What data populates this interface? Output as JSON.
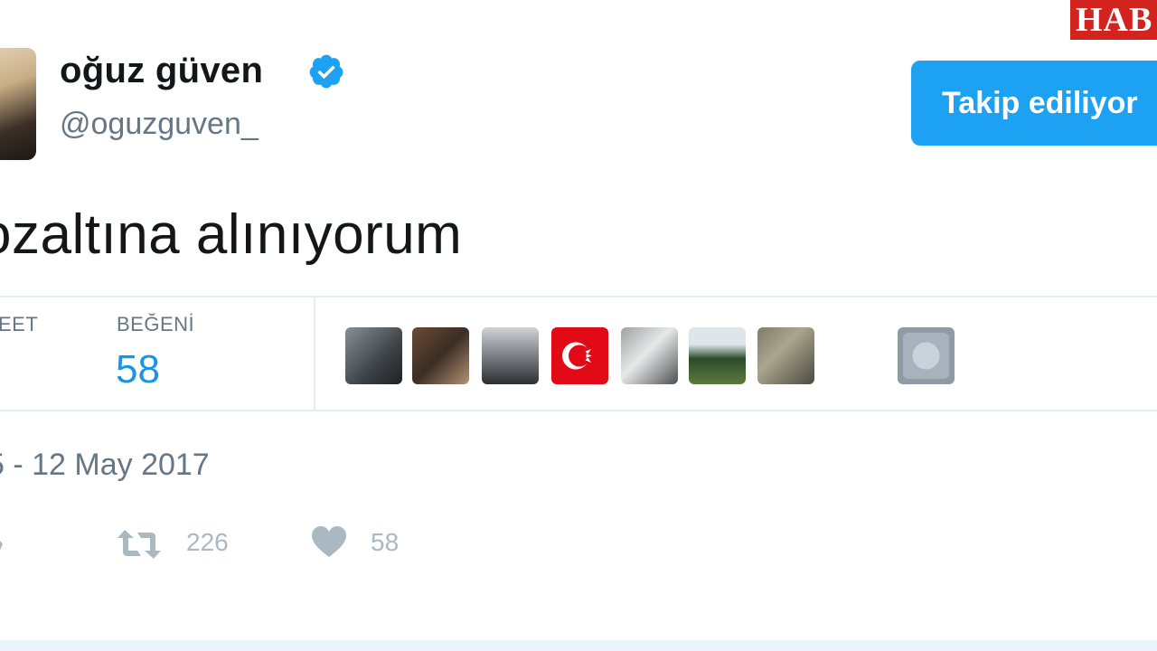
{
  "watermark": {
    "text": "HAB"
  },
  "user": {
    "display_name": "oğuz güven",
    "handle": "@oguzguven_",
    "verified": true
  },
  "follow_button": {
    "label": "Takip ediliyor"
  },
  "tweet": {
    "text": "ozaltına alınıyorum"
  },
  "stats": {
    "retweet_label": "EET",
    "retweet_value": "",
    "like_label": "BEĞENİ",
    "like_value": "58"
  },
  "likers": [
    "avatar",
    "avatar",
    "avatar",
    "turkish-flag-avatar",
    "avatar",
    "avatar",
    "avatar",
    "avatar"
  ],
  "timestamp": "5 - 12 May 2017",
  "actions": {
    "retweet_count": "226",
    "like_count": "58"
  },
  "colors": {
    "accent": "#1da1f2",
    "stat_value": "#1b95e0",
    "muted": "#657786",
    "action": "#aab8c2",
    "flag_red": "#e30a17"
  }
}
